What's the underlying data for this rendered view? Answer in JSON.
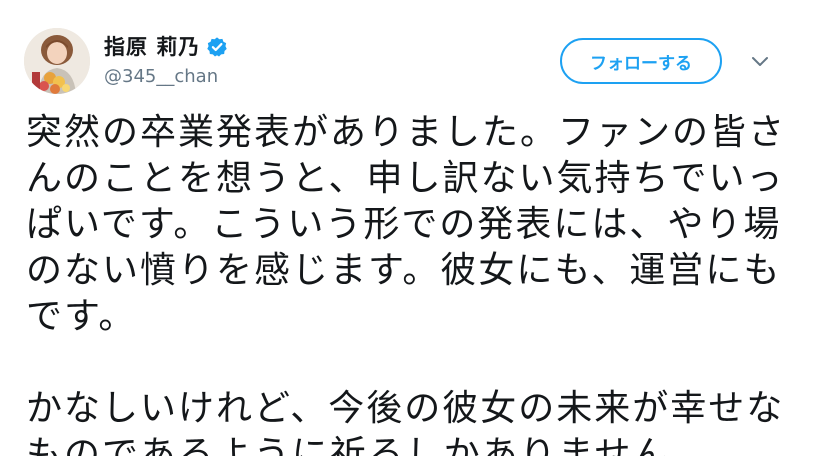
{
  "user": {
    "display_name": "指原 莉乃",
    "handle": "@345__chan",
    "verified_icon": "verified-badge-icon",
    "avatar_icon": "avatar-photo"
  },
  "actions": {
    "follow_label": "フォローする",
    "more_icon": "chevron-down-icon"
  },
  "colors": {
    "accent": "#1da1f2",
    "text": "#14171a",
    "secondary": "#657786"
  },
  "tweet": {
    "lines": [
      "突然の卒業発表がありました。ファンの皆さ",
      "んのことを想うと、申し訳ない気持ちでいっ",
      "ぱいです。こういう形での発表には、やり場",
      "のない憤りを感じます。彼女にも、運営にも",
      "です。",
      "",
      "かなしいけれど、今後の彼女の未来が幸せな",
      "ものであるように祈るしかありません。"
    ]
  }
}
